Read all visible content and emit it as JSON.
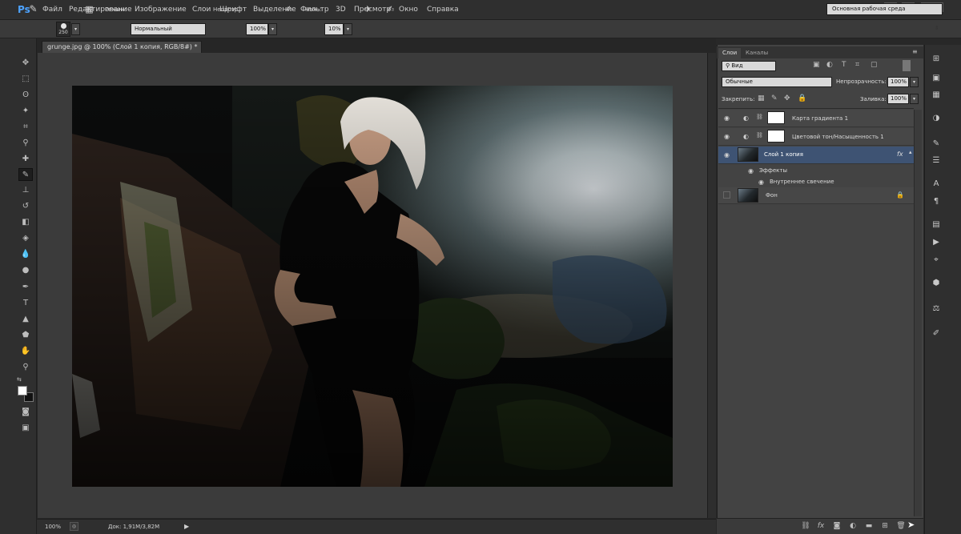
{
  "app": {
    "logo": "Ps"
  },
  "menu": [
    "Файл",
    "Редактирование",
    "Изображение",
    "Слои",
    "Шрифт",
    "Выделение",
    "Фильтр",
    "3D",
    "Просмотр",
    "Окно",
    "Справка"
  ],
  "window_controls": {
    "minimize": "▬",
    "maximize": "□",
    "close": "✕"
  },
  "options": {
    "brush_size": "250",
    "mode_label": "Режим:",
    "mode_value": "Нормальный",
    "opacity_label": "Непрозр.:",
    "opacity_value": "100%",
    "pressure_label": "Наж.:",
    "pressure_value": "10%",
    "workspace": "Основная рабочая среда"
  },
  "document": {
    "tab_title": "grunge.jpg @ 100% (Слой 1 копия, RGB/8#) *",
    "tab_close": "×"
  },
  "status": {
    "zoom": "100%",
    "doc_info": "Док: 1,91M/3,82M"
  },
  "panel": {
    "tabs": [
      "Слои",
      "Каналы"
    ],
    "filter_label": "Вид",
    "blend_mode": "Обычные",
    "opacity_label": "Непрозрачность:",
    "opacity_value": "100%",
    "lock_label": "Закрепить:",
    "fill_label": "Заливка:",
    "fill_value": "100%",
    "layers": [
      {
        "name": "Карта градиента 1"
      },
      {
        "name": "Цветовой тон/Насыщенность 1"
      },
      {
        "name": "Слой 1 копия",
        "fx": "fx",
        "effects_label": "Эффекты",
        "effect": "Внутреннее свечение"
      },
      {
        "name": "Фон"
      }
    ]
  },
  "colors": {
    "accent": "#3e5373",
    "ps_blue": "#4da3ff"
  }
}
